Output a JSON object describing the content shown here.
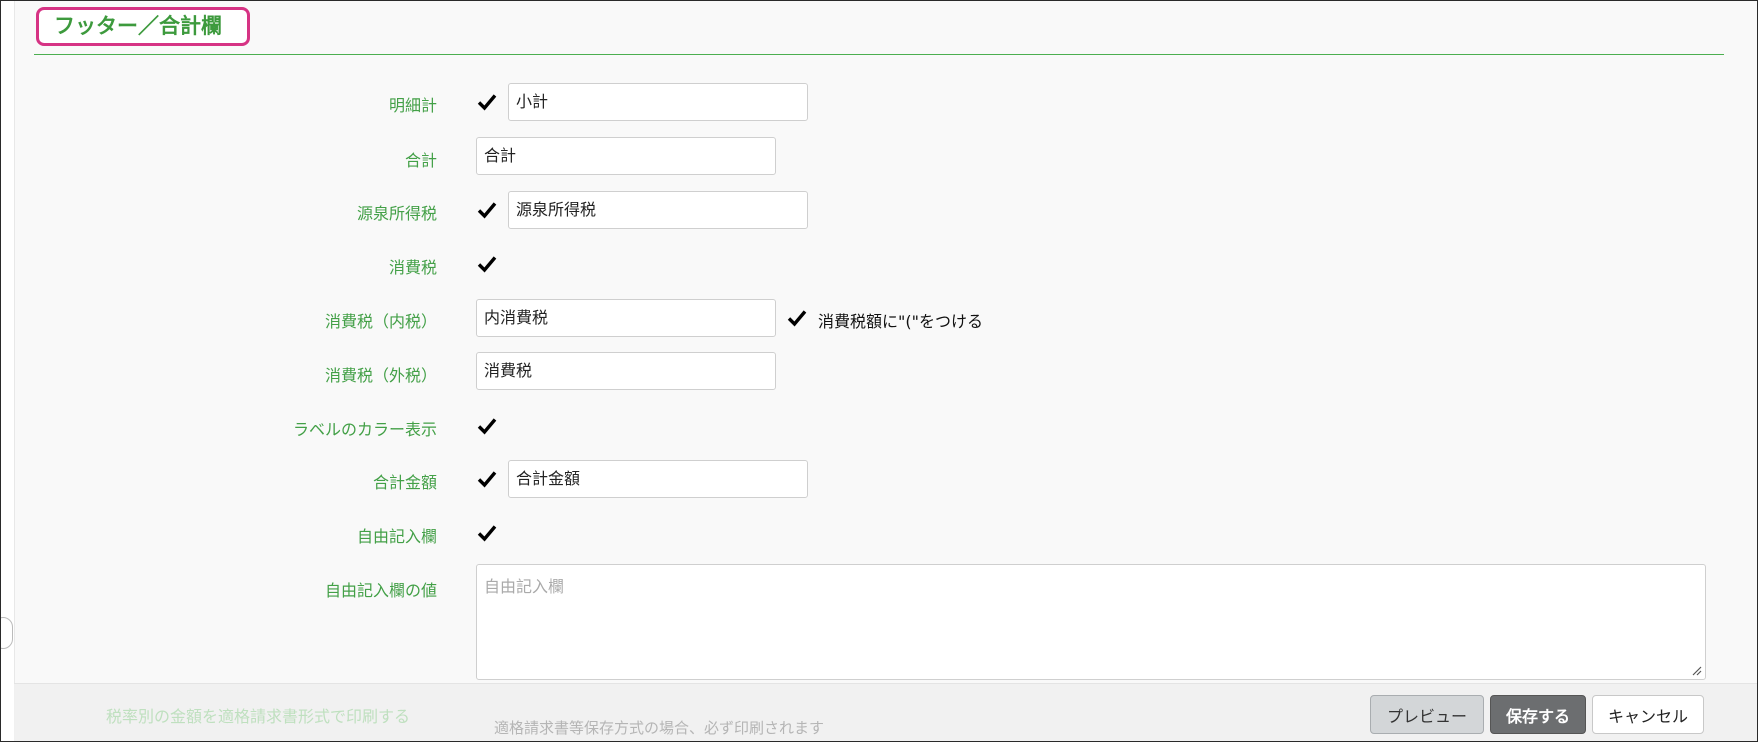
{
  "section": {
    "title": "フッター／合計欄"
  },
  "fields": {
    "meisaikei": {
      "label": "明細計",
      "checked": true,
      "value": "小計"
    },
    "goukei": {
      "label": "合計",
      "value": "合計"
    },
    "gensen": {
      "label": "源泉所得税",
      "checked": true,
      "value": "源泉所得税"
    },
    "shouhizei": {
      "label": "消費税",
      "checked": true
    },
    "uchizei": {
      "label": "消費税（内税）",
      "value": "内消費税",
      "option_checked": true,
      "option_label": "消費税額に\"(\"をつける"
    },
    "sotozei": {
      "label": "消費税（外税）",
      "value": "消費税"
    },
    "label_color": {
      "label": "ラベルのカラー表示",
      "checked": true
    },
    "goukei_kingaku": {
      "label": "合計金額",
      "checked": true,
      "value": "合計金額"
    },
    "jiyuu": {
      "label": "自由記入欄",
      "checked": true
    },
    "jiyuu_value": {
      "label": "自由記入欄の値",
      "placeholder": "自由記入欄",
      "value": ""
    },
    "tax_rate_print": {
      "label": "税率別の金額を適格請求書形式で印刷する",
      "note": "適格請求書等保存方式の場合、必ず印刷されます"
    }
  },
  "buttons": {
    "preview": "プレビュー",
    "save": "保存する",
    "cancel": "キャンセル"
  },
  "colors": {
    "accent_green": "#43a047",
    "highlight_pink": "#d63384",
    "save_button": "#6c6e70"
  }
}
